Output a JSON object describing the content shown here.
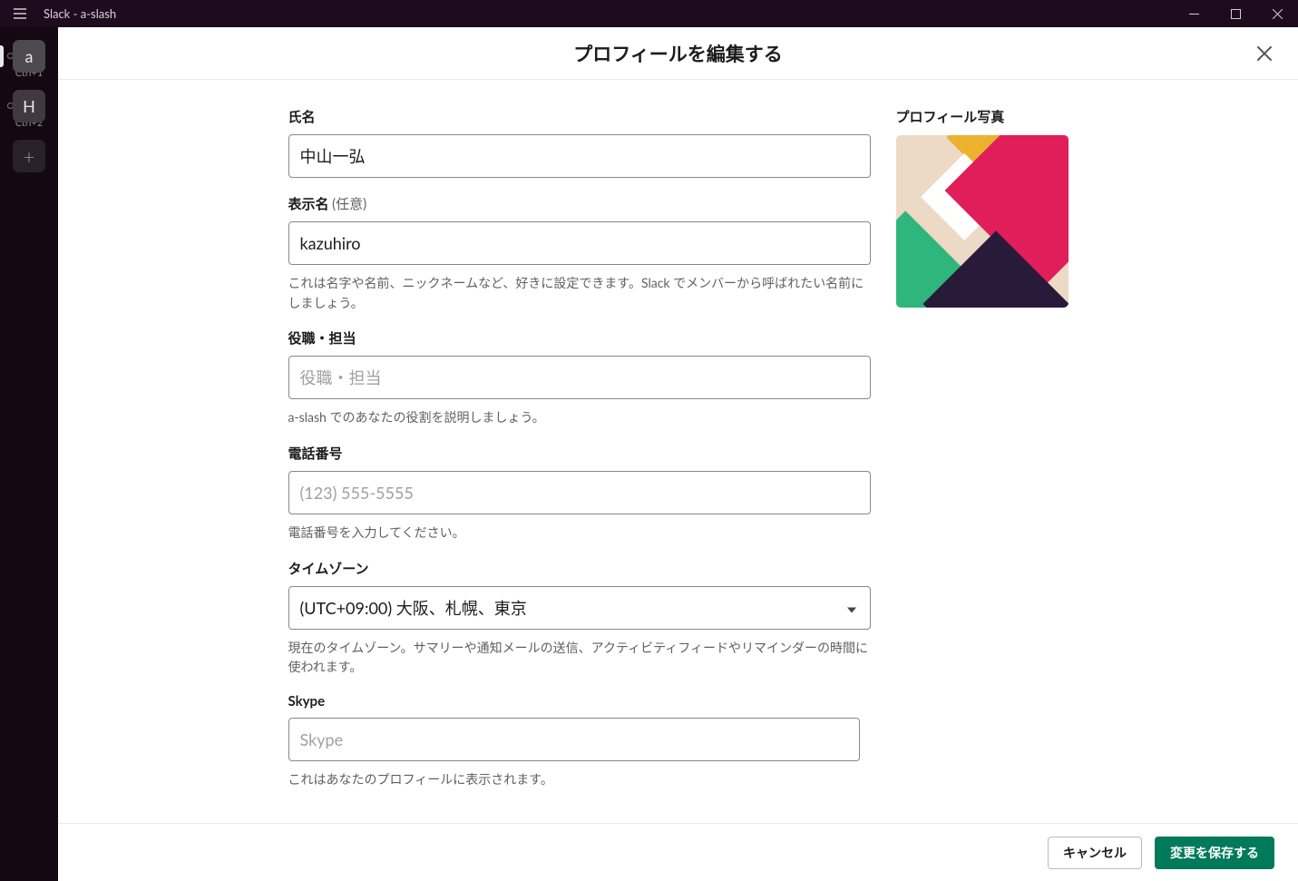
{
  "window": {
    "title": "Slack - a-slash"
  },
  "rail": {
    "items": [
      {
        "letter": "a",
        "shortcut": "Ctrl+1",
        "active": true
      },
      {
        "letter": "H",
        "shortcut": "Ctrl+2",
        "active": false
      }
    ]
  },
  "modal": {
    "title": "プロフィールを編集する"
  },
  "form": {
    "full_name": {
      "label": "氏名",
      "value": "中山一弘"
    },
    "display_name": {
      "label": "表示名",
      "optional": "(任意)",
      "value": "kazuhiro",
      "help": "これは名字や名前、ニックネームなど、好きに設定できます。Slack でメンバーから呼ばれたい名前にしましょう。"
    },
    "role": {
      "label": "役職・担当",
      "placeholder": "役職・担当",
      "value": "",
      "help": "a-slash でのあなたの役割を説明しましょう。"
    },
    "phone": {
      "label": "電話番号",
      "placeholder": "(123) 555-5555",
      "value": "",
      "help": "電話番号を入力してください。"
    },
    "timezone": {
      "label": "タイムゾーン",
      "value": "(UTC+09:00) 大阪、札幌、東京",
      "help": "現在のタイムゾーン。サマリーや通知メールの送信、アクティビティフィードやリマインダーの時間に使われます。"
    },
    "skype": {
      "label": "Skype",
      "placeholder": "Skype",
      "value": "",
      "help": "これはあなたのプロフィールに表示されます。"
    },
    "photo": {
      "label": "プロフィール写真"
    }
  },
  "footer": {
    "cancel": "キャンセル",
    "save": "変更を保存する"
  }
}
